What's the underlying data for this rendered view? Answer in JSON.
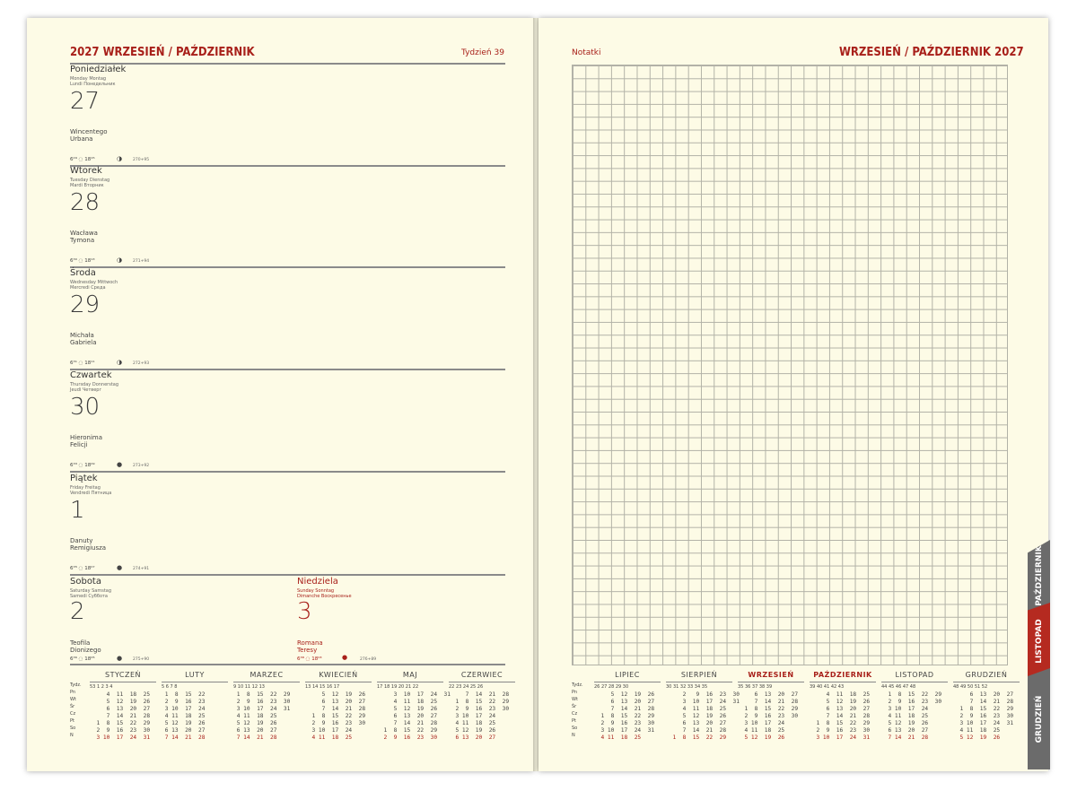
{
  "left": {
    "title": "2027 WRZESIEŃ / PAŹDZIERNIK",
    "week": "Tydzień 39",
    "days": [
      {
        "name": "Poniedziałek",
        "trans1": "Monday  Montag",
        "trans2": "Lundi  Понедельник",
        "num": "27",
        "names1": "Wincentego",
        "names2": "Urbana",
        "sun": "6²⁹ ◌ 18¹⁵",
        "moon": "◑",
        "yday": "270+95"
      },
      {
        "name": "Wtorek",
        "trans1": "Tuesday  Dienstag",
        "trans2": "Mardi  Вторник",
        "num": "28",
        "names1": "Wacława",
        "names2": "Tymona",
        "sun": "6³⁰ ◌ 18¹³",
        "moon": "◑",
        "yday": "271+94"
      },
      {
        "name": "Środa",
        "trans1": "Wednesday  Mittwoch",
        "trans2": "Mercredi  Среда",
        "num": "29",
        "names1": "Michała",
        "names2": "Gabriela",
        "sun": "6³¹ ◌ 18¹¹",
        "moon": "◑",
        "yday": "272+93"
      },
      {
        "name": "Czwartek",
        "trans1": "Thursday  Donnerstag",
        "trans2": "Jeudi  Четверг",
        "num": "30",
        "names1": "Hieronima",
        "names2": "Felicji",
        "sun": "6³³ ◌ 18⁰⁹",
        "moon": "●",
        "yday": "273+92"
      },
      {
        "name": "Piątek",
        "trans1": "Friday  Freitag",
        "trans2": "Vendredi  Пятница",
        "num": "1",
        "names1": "Danuty",
        "names2": "Remigiusza",
        "sun": "6³⁵ ◌ 18⁰⁷",
        "moon": "●",
        "yday": "274+91"
      }
    ],
    "saturday": {
      "name": "Sobota",
      "trans1": "Saturday  Samstag",
      "trans2": "Samedi  Суббота",
      "num": "2",
      "names1": "Teofila",
      "names2": "Dionizego",
      "sun": "6³⁶ ◌ 18⁰⁵",
      "moon": "●",
      "yday": "275+90"
    },
    "sunday": {
      "name": "Niedziela",
      "trans1": "Sunday  Sonntag",
      "trans2": "Dimanche  Воскресенье",
      "num": "3",
      "names1": "Romana",
      "names2": "Teresy",
      "sun": "6³⁸ ◌ 18⁰³",
      "moon": "●",
      "yday": "276+89"
    },
    "cal_daynames": "Tydz.\nPn\nWt\nŚr\nCz\nPt\nSo\nN",
    "months": [
      {
        "name": "STYCZEŃ",
        "weeks": "53   1    2    3    4",
        "rows": [
          "     4  11  18  25",
          "     5  12  19  26",
          "     6  13  20  27",
          "     7  14  21  28",
          "  1  8  15  22  29",
          "  2  9  16  23  30",
          "  3 10  17  24  31"
        ]
      },
      {
        "name": "LUTY",
        "weeks": "5    6    7    8",
        "rows": [
          " 1  8  15  22",
          " 2  9  16  23",
          " 3 10  17  24",
          " 4 11  18  25",
          " 5 12  19  26",
          " 6 13  20  27",
          " 7 14  21  28"
        ]
      },
      {
        "name": "MARZEC",
        "weeks": "9   10   11   12   13",
        "rows": [
          " 1  8  15  22  29",
          " 2  9  16  23  30",
          " 3 10  17  24  31",
          " 4 11  18  25",
          " 5 12  19  26",
          " 6 13  20  27",
          " 7 14  21  28"
        ]
      },
      {
        "name": "KWIECIEŃ",
        "weeks": "13   14   15   16   17",
        "rows": [
          "     5  12  19  26",
          "     6  13  20  27",
          "     7  14  21  28",
          "  1  8  15  22  29",
          "  2  9  16  23  30",
          "  3 10  17  24",
          "  4 11  18  25"
        ]
      },
      {
        "name": "MAJ",
        "weeks": "17   18   19   20   21   22",
        "rows": [
          "     3  10  17  24  31",
          "     4  11  18  25",
          "     5  12  19  26",
          "     6  13  20  27",
          "     7  14  21  28",
          "  1  8  15  22  29",
          "  2  9  16  23  30"
        ]
      },
      {
        "name": "CZERWIEC",
        "weeks": "22   23   24   25   26",
        "rows": [
          "     7  14  21  28",
          "  1  8  15  22  29",
          "  2  9  16  23  30",
          "  3 10  17  24",
          "  4 11  18  25",
          "  5 12  19  26",
          "  6 13  20  27"
        ]
      }
    ]
  },
  "right": {
    "notes_label": "Notatki",
    "title": "WRZESIEŃ / PAŹDZIERNIK 2027",
    "cal_daynames": "Tydz.\nPn\nWt\nŚr\nCz\nPt\nSo\nN",
    "months": [
      {
        "name": "LIPIEC",
        "weeks": "26   27   28   29   30",
        "rows": [
          "     5  12  19  26",
          "     6  13  20  27",
          "     7  14  21  28",
          "  1  8  15  22  29",
          "  2  9  16  23  30",
          "  3 10  17  24  31",
          "  4 11  18  25"
        ]
      },
      {
        "name": "SIERPIEŃ",
        "weeks": "30   31   32   33   34   35",
        "rows": [
          "     2   9  16  23  30",
          "     3  10  17  24  31",
          "     4  11  18  25",
          "     5  12  19  26",
          "     6  13  20  27",
          "     7  14  21  28",
          "  1  8  15  22  29"
        ]
      },
      {
        "name": "WRZESIEŃ",
        "weeks": "35   36   37   38   39",
        "rows": [
          "     6  13  20  27",
          "     7  14  21  28",
          "  1  8  15  22  29",
          "  2  9  16  23  30",
          "  3 10  17  24",
          "  4 11  18  25",
          "  5 12  19  26"
        ]
      },
      {
        "name": "PAŹDZIERNIK",
        "weeks": "39   40   41   42   43",
        "rows": [
          "     4  11  18  25",
          "     5  12  19  26",
          "     6  13  20  27",
          "     7  14  21  28",
          "  1  8  15  22  29",
          "  2  9  16  23  30",
          "  3 10  17  24  31"
        ]
      },
      {
        "name": "LISTOPAD",
        "weeks": "44   45   46   47   48",
        "rows": [
          "  1  8  15  22  29",
          "  2  9  16  23  30",
          "  3 10  17  24",
          "  4 11  18  25",
          "  5 12  19  26",
          "  6 13  20  27",
          "  7 14  21  28"
        ]
      },
      {
        "name": "GRUDZIEŃ",
        "weeks": "48   49   50   51   52",
        "rows": [
          "     6  13  20  27",
          "     7  14  21  28",
          "  1  8  15  22  29",
          "  2  9  16  23  30",
          "  3 10  17  24  31",
          "  4 11  18  25",
          "  5 12  19  26"
        ]
      }
    ],
    "tabs": [
      "PAŹDZIERNIK",
      "LISTOPAD",
      "GRUDZIEŃ"
    ]
  },
  "colors": {
    "accent": "#a8201a",
    "paper": "#fdfbe6",
    "tab_gray": "#6b6b6b"
  }
}
